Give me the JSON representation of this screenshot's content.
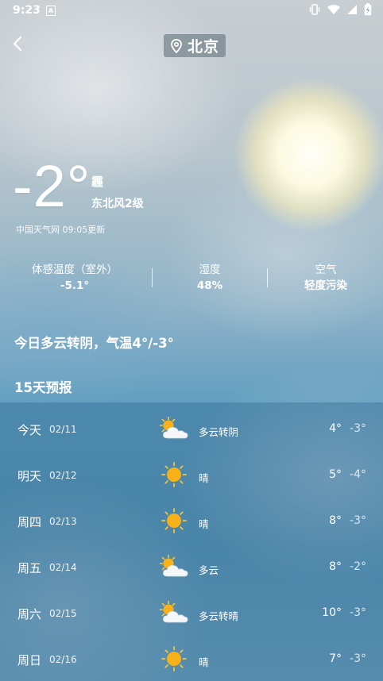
{
  "status_bar": {
    "time": "9:23",
    "notification_glyph": "A",
    "icons": [
      "vibrate-icon",
      "wifi-icon",
      "cell-signal-icon",
      "battery-charging-icon"
    ]
  },
  "header": {
    "back_icon": "chevron-left-icon",
    "location_icon": "location-pin-icon",
    "city": "北京"
  },
  "current": {
    "temperature": "-2°",
    "condition": "霾",
    "wind": "东北风2级",
    "update_info": "中国天气网 09:05更新"
  },
  "details": [
    {
      "label": "体感温度（室外）",
      "value": "-5.1°"
    },
    {
      "label": "湿度",
      "value": "48%"
    },
    {
      "label": "空气",
      "value": "轻度污染"
    }
  ],
  "summary": "今日多云转阴，气温4°/-3°",
  "forecast_title": "15天预报",
  "forecast": [
    {
      "day": "今天",
      "date": "02/11",
      "icon": "partly-cloudy-icon",
      "condition": "多云转阴",
      "high": "4°",
      "low": "-3°"
    },
    {
      "day": "明天",
      "date": "02/12",
      "icon": "sunny-icon",
      "condition": "晴",
      "high": "5°",
      "low": "-4°"
    },
    {
      "day": "周四",
      "date": "02/13",
      "icon": "sunny-icon",
      "condition": "晴",
      "high": "8°",
      "low": "-3°"
    },
    {
      "day": "周五",
      "date": "02/14",
      "icon": "partly-cloudy-icon",
      "condition": "多云",
      "high": "8°",
      "low": "-2°"
    },
    {
      "day": "周六",
      "date": "02/15",
      "icon": "partly-cloudy-icon",
      "condition": "多云转晴",
      "high": "10°",
      "low": "-3°"
    },
    {
      "day": "周日",
      "date": "02/16",
      "icon": "sunny-icon",
      "condition": "晴",
      "high": "7°",
      "low": "-3°"
    }
  ],
  "colors": {
    "sun": "#f7b21a",
    "sun_ray": "#f9c43a",
    "cloud": "#f4f6f8",
    "panel": "#285f87"
  }
}
